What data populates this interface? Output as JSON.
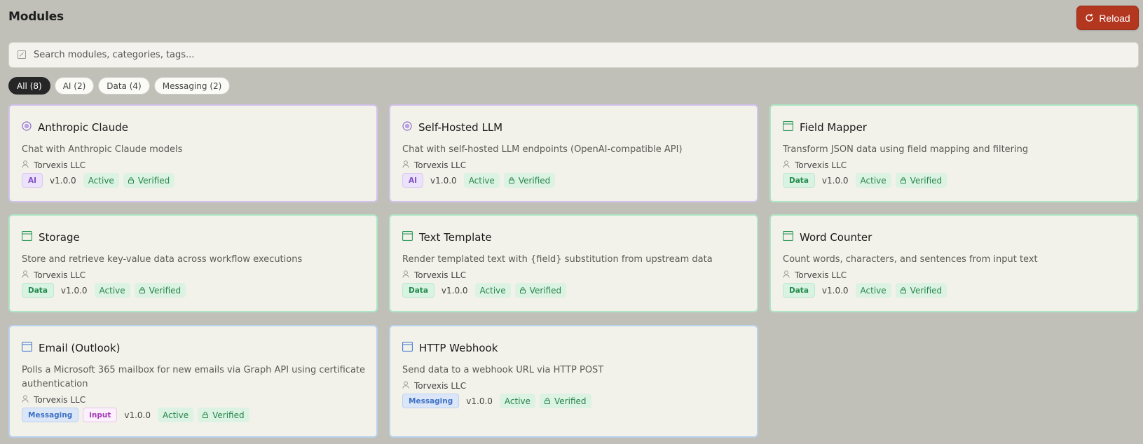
{
  "header": {
    "title": "Modules",
    "reload_label": "Reload"
  },
  "search": {
    "placeholder": "Search modules, categories, tags..."
  },
  "filters": [
    {
      "label": "All (8)",
      "active": true
    },
    {
      "label": "AI (2)",
      "active": false
    },
    {
      "label": "Data (4)",
      "active": false
    },
    {
      "label": "Messaging (2)",
      "active": false
    }
  ],
  "icons": {
    "ai": "circle-icon",
    "data": "window-icon",
    "messaging": "window-icon",
    "author": "user-icon",
    "verified": "lock-icon",
    "search": "search-icon",
    "reload": "reload-icon"
  },
  "colors": {
    "accent": "#b3361f",
    "ai": "#7c4fc4",
    "data": "#23894d",
    "messaging": "#3f71c4"
  },
  "modules": [
    {
      "name": "Anthropic Claude",
      "description": "Chat with Anthropic Claude models",
      "author": "Torvexis LLC",
      "category": "AI",
      "tags": [
        "AI"
      ],
      "version": "v1.0.0",
      "status": "Active",
      "verified": "Verified"
    },
    {
      "name": "Self-Hosted LLM",
      "description": "Chat with self-hosted LLM endpoints (OpenAI-compatible API)",
      "author": "Torvexis LLC",
      "category": "AI",
      "tags": [
        "AI"
      ],
      "version": "v1.0.0",
      "status": "Active",
      "verified": "Verified"
    },
    {
      "name": "Field Mapper",
      "description": "Transform JSON data using field mapping and filtering",
      "author": "Torvexis LLC",
      "category": "Data",
      "tags": [
        "Data"
      ],
      "version": "v1.0.0",
      "status": "Active",
      "verified": "Verified"
    },
    {
      "name": "Storage",
      "description": "Store and retrieve key-value data across workflow executions",
      "author": "Torvexis LLC",
      "category": "Data",
      "tags": [
        "Data"
      ],
      "version": "v1.0.0",
      "status": "Active",
      "verified": "Verified"
    },
    {
      "name": "Text Template",
      "description": "Render templated text with {field} substitution from upstream data",
      "author": "Torvexis LLC",
      "category": "Data",
      "tags": [
        "Data"
      ],
      "version": "v1.0.0",
      "status": "Active",
      "verified": "Verified"
    },
    {
      "name": "Word Counter",
      "description": "Count words, characters, and sentences from input text",
      "author": "Torvexis LLC",
      "category": "Data",
      "tags": [
        "Data"
      ],
      "version": "v1.0.0",
      "status": "Active",
      "verified": "Verified"
    },
    {
      "name": "Email (Outlook)",
      "description": "Polls a Microsoft 365 mailbox for new emails via Graph API using certificate authentication",
      "author": "Torvexis LLC",
      "category": "Messaging",
      "tags": [
        "Messaging",
        "input"
      ],
      "version": "v1.0.0",
      "status": "Active",
      "verified": "Verified"
    },
    {
      "name": "HTTP Webhook",
      "description": "Send data to a webhook URL via HTTP POST",
      "author": "Torvexis LLC",
      "category": "Messaging",
      "tags": [
        "Messaging"
      ],
      "version": "v1.0.0",
      "status": "Active",
      "verified": "Verified"
    }
  ]
}
